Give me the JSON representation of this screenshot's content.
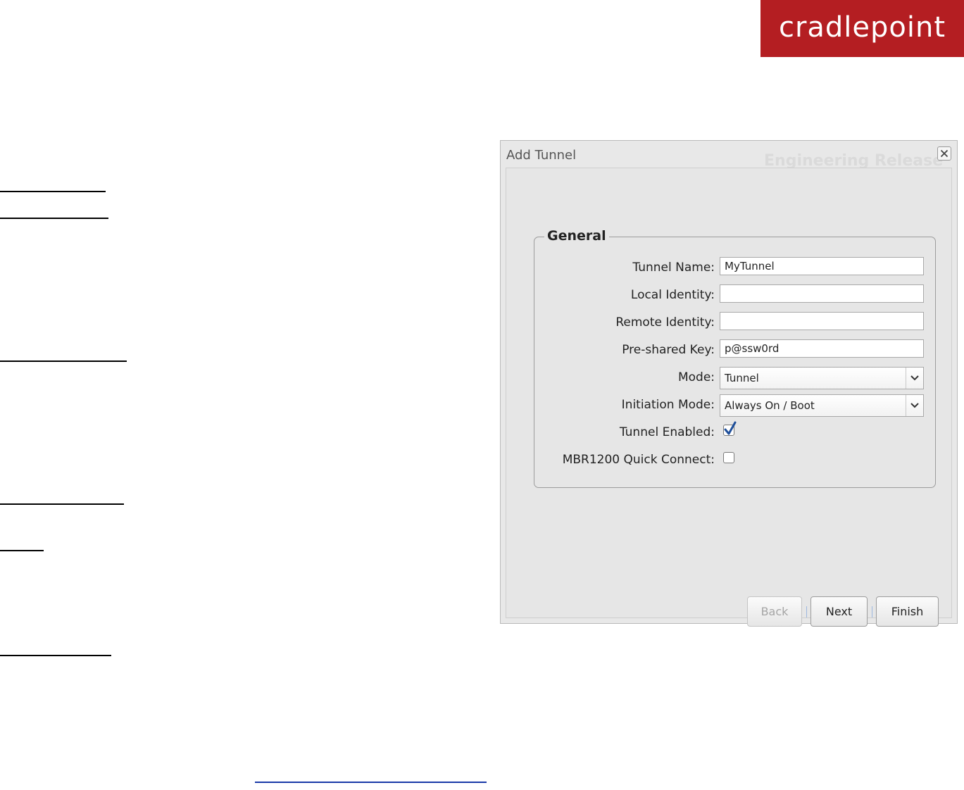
{
  "brand": {
    "logo_text": "cradlepoint",
    "color": "#b41e22"
  },
  "dialog": {
    "title": "Add Tunnel",
    "watermark": "Engineering Release",
    "group_title": "General",
    "fields": {
      "tunnel_name": {
        "label": "Tunnel Name:",
        "value": "MyTunnel"
      },
      "local_identity": {
        "label": "Local Identity:",
        "value": ""
      },
      "remote_identity": {
        "label": "Remote Identity:",
        "value": ""
      },
      "pre_shared_key": {
        "label": "Pre-shared Key:",
        "value": "p@ssw0rd"
      },
      "mode": {
        "label": "Mode:",
        "value": "Tunnel"
      },
      "initiation_mode": {
        "label": "Initiation Mode:",
        "value": "Always On / Boot"
      },
      "tunnel_enabled": {
        "label": "Tunnel Enabled:",
        "checked": true
      },
      "quick_connect": {
        "label": "MBR1200 Quick Connect:",
        "checked": false
      }
    },
    "buttons": {
      "back": "Back",
      "next": "Next",
      "finish": "Finish"
    }
  },
  "icons": {
    "close": "close-icon",
    "dropdown": "chevron-down-icon",
    "check": "checkmark-icon"
  }
}
